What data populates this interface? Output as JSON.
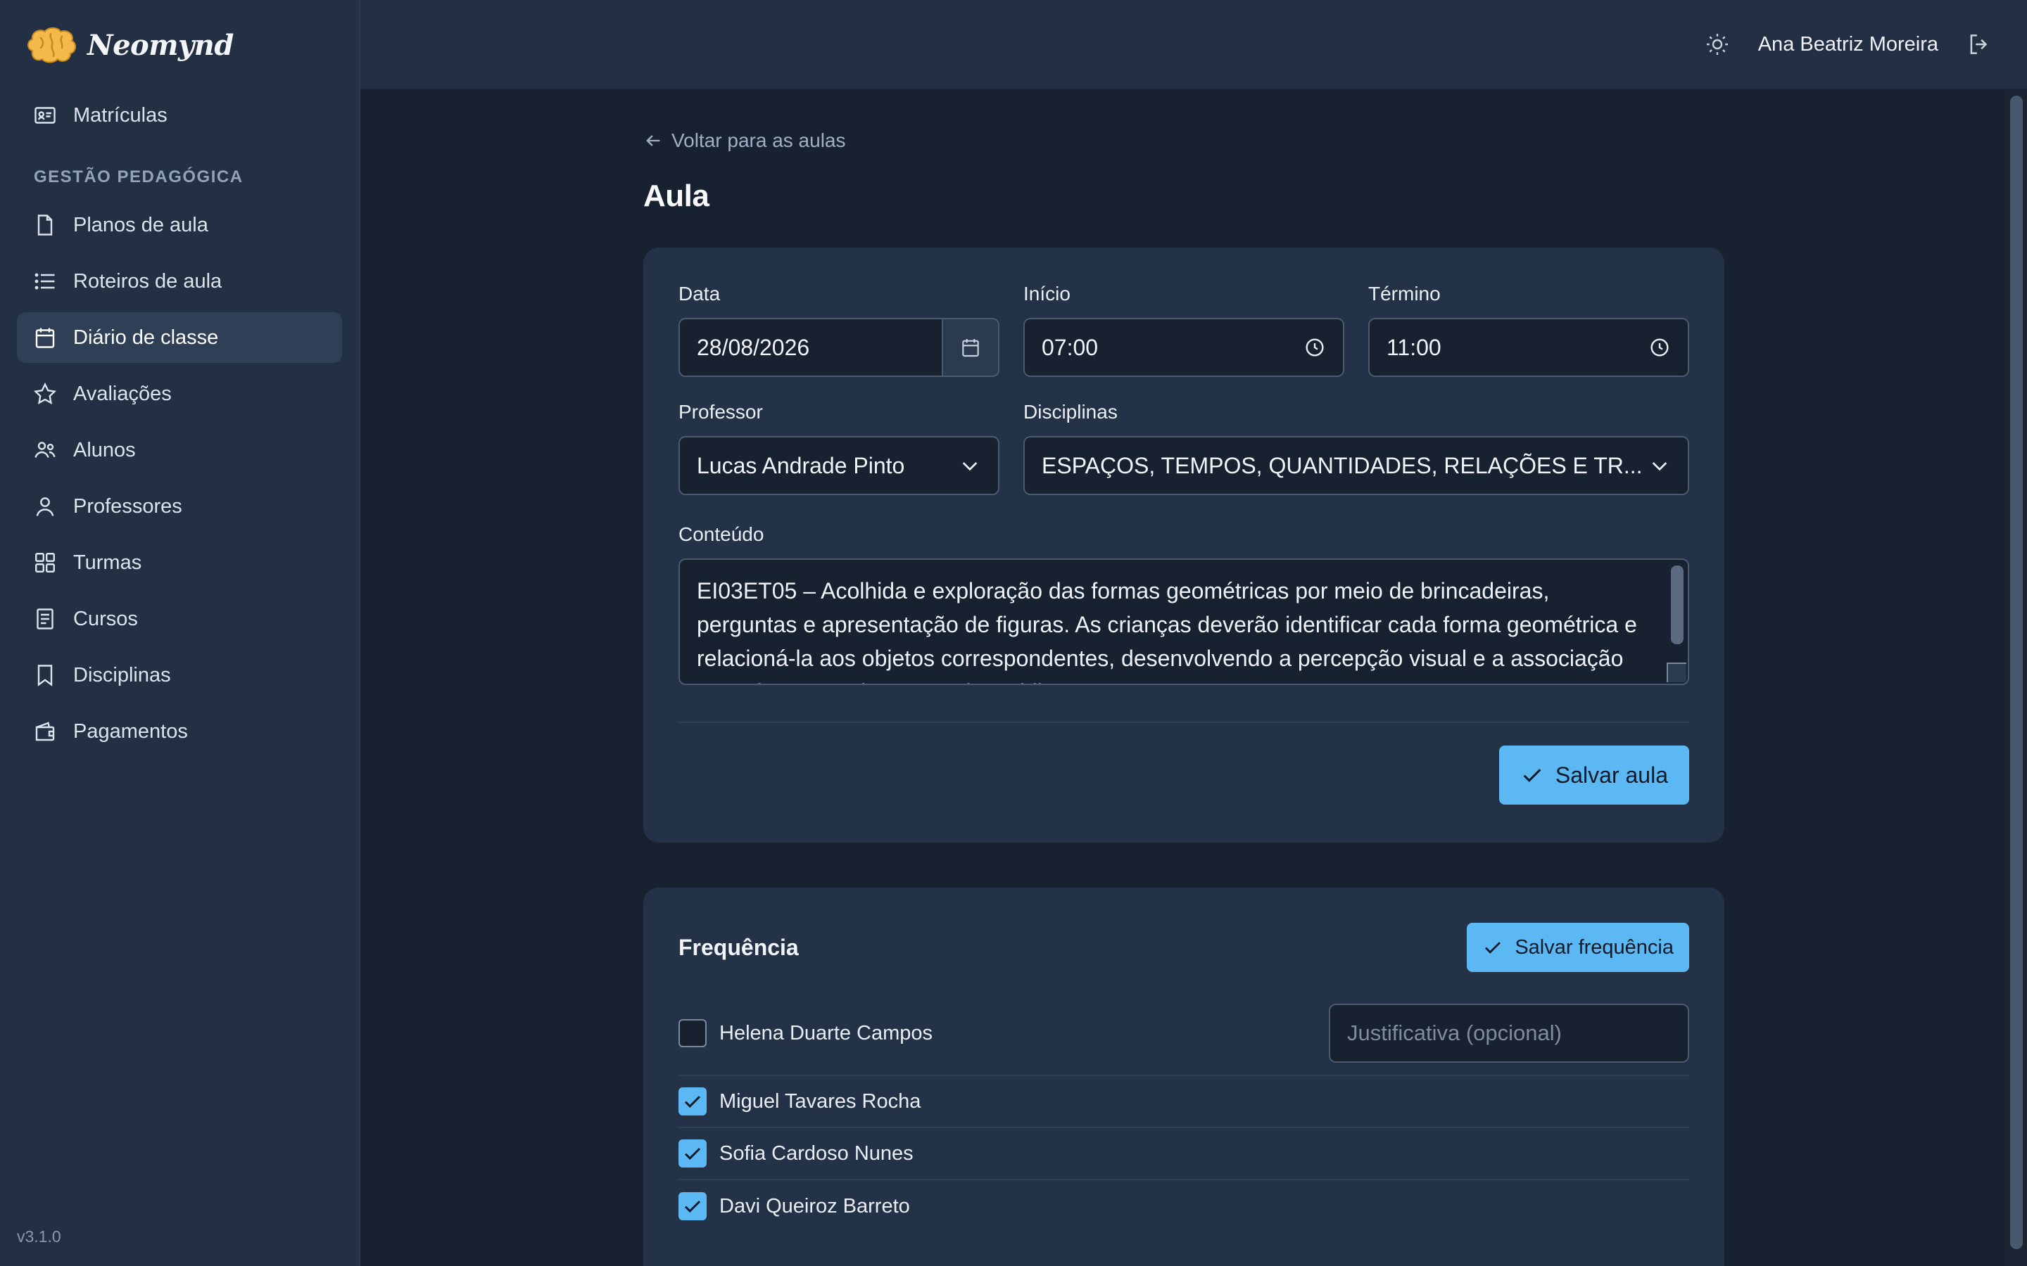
{
  "brand": {
    "name": "Neomynd"
  },
  "sidebar": {
    "top_items": [
      {
        "label": "Matrículas",
        "icon": "id-card-icon"
      }
    ],
    "section_title": "GESTÃO PEDAGÓGICA",
    "items": [
      {
        "label": "Planos de aula",
        "icon": "file-icon"
      },
      {
        "label": "Roteiros de aula",
        "icon": "list-icon"
      },
      {
        "label": "Diário de classe",
        "icon": "calendar-icon",
        "active": true
      },
      {
        "label": "Avaliações",
        "icon": "star-icon"
      },
      {
        "label": "Alunos",
        "icon": "users-icon"
      },
      {
        "label": "Professores",
        "icon": "user-icon"
      },
      {
        "label": "Turmas",
        "icon": "grid-icon"
      },
      {
        "label": "Cursos",
        "icon": "book-icon"
      },
      {
        "label": "Disciplinas",
        "icon": "bookmark-icon"
      },
      {
        "label": "Pagamentos",
        "icon": "wallet-icon"
      }
    ],
    "version": "v3.1.0"
  },
  "header": {
    "user_name": "Ana Beatriz Moreira",
    "theme_icon": "sun-icon",
    "logout_icon": "logout-icon"
  },
  "page": {
    "back_label": "Voltar para as aulas",
    "title": "Aula"
  },
  "form": {
    "date_label": "Data",
    "date_value": "28/08/2026",
    "start_label": "Início",
    "start_value": "07:00",
    "end_label": "Término",
    "end_value": "11:00",
    "teacher_label": "Professor",
    "teacher_value": "Lucas Andrade Pinto",
    "subjects_label": "Disciplinas",
    "subjects_value": "ESPAÇOS, TEMPOS, QUANTIDADES, RELAÇÕES E TR...",
    "content_label": "Conteúdo",
    "content_value": "EI03ET05 – Acolhida e exploração das formas geométricas por meio de brincadeiras, perguntas e apresentação de figuras. As crianças deverão identificar cada forma geométrica e relacioná-la aos objetos correspondentes, desenvolvendo a percepção visual e a associação entre formas e elementos do cotidiano.",
    "save_label": "Salvar aula"
  },
  "attendance": {
    "title": "Frequência",
    "save_label": "Salvar frequência",
    "justification_placeholder": "Justificativa (opcional)",
    "students": [
      {
        "name": "Helena Duarte Campos",
        "present": false
      },
      {
        "name": "Miguel Tavares Rocha",
        "present": true
      },
      {
        "name": "Sofia Cardoso Nunes",
        "present": true
      },
      {
        "name": "Davi Queiroz Barreto",
        "present": true
      }
    ]
  },
  "colors": {
    "accent": "#5cb8f3",
    "sidebar_bg": "#233044",
    "page_bg": "#172130",
    "card_bg": "#243247"
  }
}
